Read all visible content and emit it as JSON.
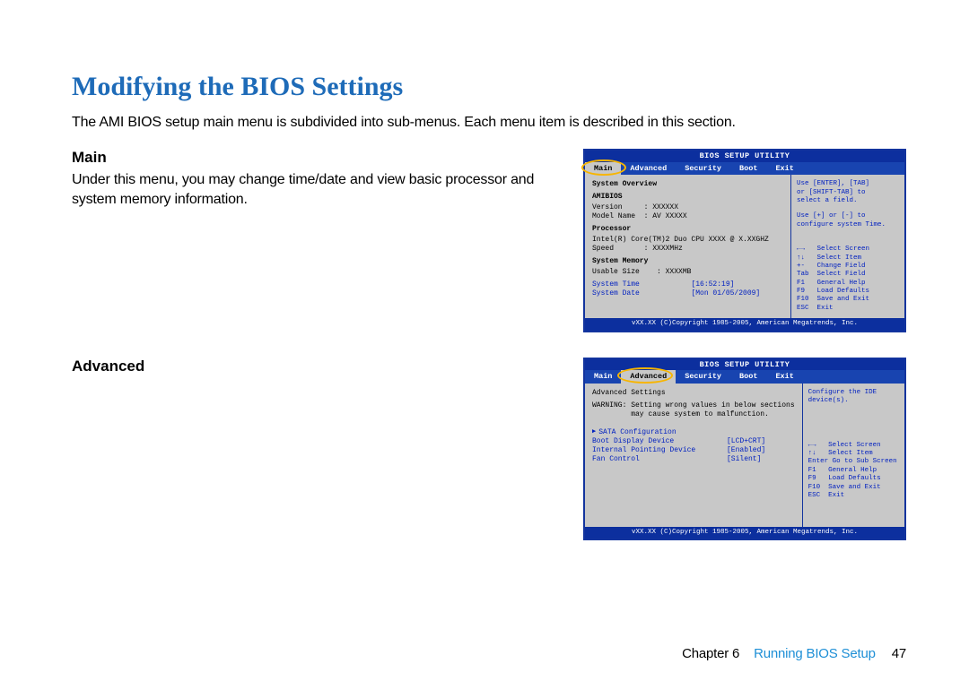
{
  "page": {
    "title": "Modifying the BIOS Settings",
    "intro": "The AMI BIOS setup main menu is subdivided into sub-menus. Each menu item is described in this section."
  },
  "sections": {
    "main": {
      "heading": "Main",
      "desc": "Under this menu, you may change time/date and view basic processor and system memory information."
    },
    "advanced": {
      "heading": "Advanced"
    }
  },
  "bios_common": {
    "utility_title": "BIOS SETUP UTILITY",
    "tabs": [
      "Main",
      "Advanced",
      "Security",
      "Boot",
      "Exit"
    ],
    "footer": "vXX.XX (C)Copyright 1985-2005, American Megatrends, Inc."
  },
  "bios_main": {
    "left": {
      "overview": "System Overview",
      "amibios": "AMIBIOS",
      "version_label": "Version",
      "version_value": ": XXXXXX",
      "model_label": "Model Name",
      "model_value": ": AV XXXXX",
      "processor_head": "Processor",
      "processor_line": "Intel(R) Core(TM)2 Duo CPU XXXX @ X.XXGHZ",
      "speed_label": "Speed",
      "speed_value": ": XXXXMHz",
      "mem_head": "System Memory",
      "mem_label": "Usable Size",
      "mem_value": ": XXXXMB",
      "time_label": "System Time",
      "time_value": "[16:52:19]",
      "date_label": "System Date",
      "date_value": "[Mon 01/05/2009]"
    },
    "right": {
      "hint1": "Use [ENTER], [TAB]\nor [SHIFT-TAB] to\nselect a field.",
      "hint2": "Use [+] or [-] to\nconfigure system Time.",
      "keys": "←→   Select Screen\n↑↓   Select Item\n+-   Change Field\nTab  Select Field\nF1   General Help\nF9   Load Defaults\nF10  Save and Exit\nESC  Exit"
    }
  },
  "bios_advanced": {
    "left": {
      "head": "Advanced Settings",
      "warning": "WARNING: Setting wrong values in below sections\n         may cause system to malfunction.",
      "items": [
        {
          "label": "SATA Configuration",
          "value": ""
        },
        {
          "label": "Boot Display Device",
          "value": "[LCD+CRT]"
        },
        {
          "label": "Internal Pointing Device",
          "value": "[Enabled]"
        },
        {
          "label": "Fan Control",
          "value": "[Silent]"
        }
      ]
    },
    "right": {
      "hint1": "Configure the IDE\ndevice(s).",
      "keys": "←→   Select Screen\n↑↓   Select Item\nEnter Go to Sub Screen\nF1   General Help\nF9   Load Defaults\nF10  Save and Exit\nESC  Exit"
    }
  },
  "footer": {
    "chapter": "Chapter 6",
    "title": "Running BIOS Setup",
    "page": "47"
  }
}
